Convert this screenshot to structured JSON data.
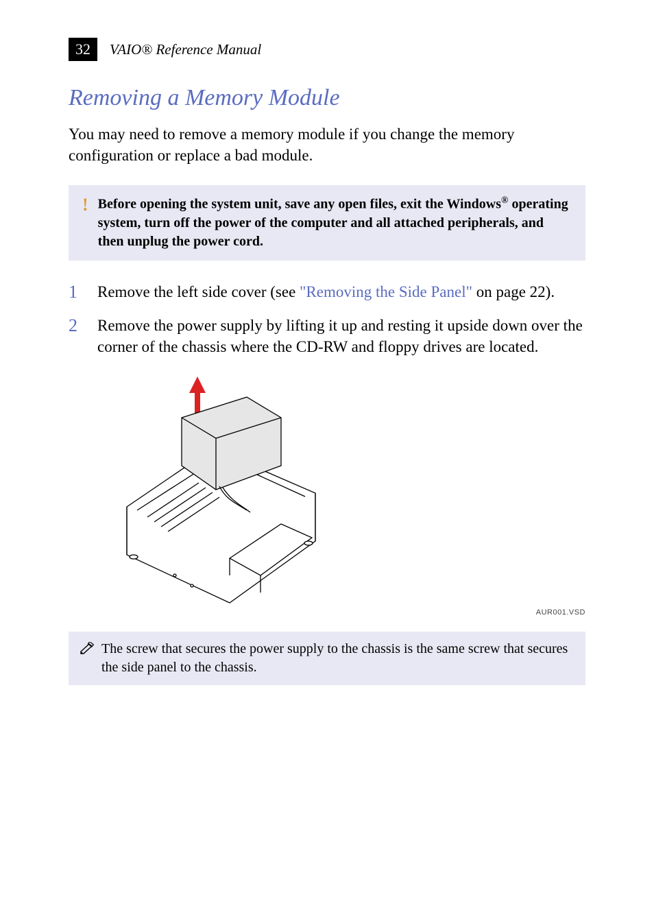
{
  "header": {
    "page_number": "32",
    "running_title": "VAIO® Reference Manual"
  },
  "section_title": "Removing a Memory Module",
  "intro": "You may need to remove a memory module if you change the memory configuration or replace a bad module.",
  "warning": {
    "marker": "!",
    "text_before_sup": "Before opening the system unit, save any open files, exit the Windows",
    "sup": "®",
    "text_after_sup": " operating system, turn off the power of the computer and all attached peripherals, and then unplug the power cord."
  },
  "steps": [
    {
      "num": "1",
      "pre_link": "Remove the left side cover (see ",
      "link": "\"Removing the Side Panel\"",
      "post_link": " on page 22)."
    },
    {
      "num": "2",
      "pre_link": "Remove the power supply by lifting it up and resting it upside down over the corner of the chassis where the CD-RW and floppy drives are located.",
      "link": "",
      "post_link": ""
    }
  ],
  "figure": {
    "caption": "AUR001.VSD",
    "alt": "Line drawing of an open computer chassis with the power supply being lifted out; a red arrow points upward indicating the lift direction."
  },
  "note": {
    "text": "The screw that secures the power supply to the chassis is the same screw that secures the side panel to the chassis."
  }
}
